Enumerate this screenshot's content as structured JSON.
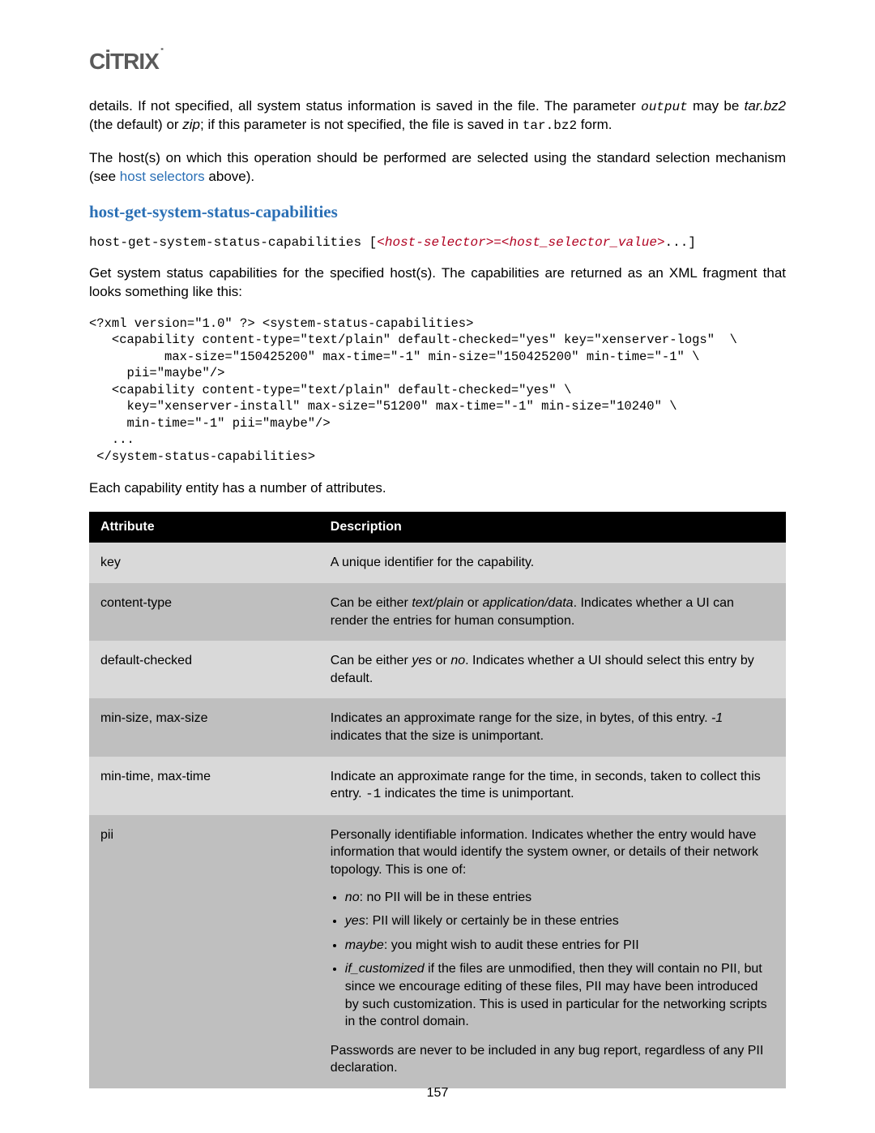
{
  "logo": {
    "text": "CİTRIX",
    "trademark": "˙"
  },
  "intro": {
    "p1_a": "details. If not specified, all system status information is saved in the file. The parameter ",
    "p1_output": "output",
    "p1_b": " may be ",
    "p1_tarbz2": "tar.bz2",
    "p1_c": " (the default) or ",
    "p1_zip": "zip",
    "p1_d": "; if this parameter is not specified, the file is saved in ",
    "p1_tarbz2_mono": "tar.bz2",
    "p1_e": " form.",
    "p2_a": "The host(s) on which this operation should be performed are selected using the standard selection mechanism (see ",
    "p2_link": "host selectors",
    "p2_b": " above)."
  },
  "section_heading": "host-get-system-status-capabilities",
  "cmd": {
    "name": "host-get-system-status-capabilities",
    "open": " [",
    "sel": "<host-selector>",
    "eq": "=",
    "val": "<host_selector_value>",
    "close": "...]"
  },
  "desc_para": "Get system status capabilities for the specified host(s). The capabilities are returned as an XML fragment that looks something like this:",
  "xml_block": "<?xml version=\"1.0\" ?> <system-status-capabilities>\n   <capability content-type=\"text/plain\" default-checked=\"yes\" key=\"xenserver-logs\"  \\\n          max-size=\"150425200\" max-time=\"-1\" min-size=\"150425200\" min-time=\"-1\" \\\n     pii=\"maybe\"/>\n   <capability content-type=\"text/plain\" default-checked=\"yes\" \\\n     key=\"xenserver-install\" max-size=\"51200\" max-time=\"-1\" min-size=\"10240\" \\\n     min-time=\"-1\" pii=\"maybe\"/>\n   ...\n </system-status-capabilities>",
  "attrs_intro": "Each capability entity has a number of attributes.",
  "table": {
    "head_attr": "Attribute",
    "head_desc": "Description",
    "rows": [
      {
        "attr": "key",
        "desc_plain": "A unique identifier for the capability."
      },
      {
        "attr": "content-type",
        "desc_a": "Can be either ",
        "it1": "text/plain",
        "desc_b": " or ",
        "it2": "application/data",
        "desc_c": ". Indicates whether a UI can render the entries for human consumption."
      },
      {
        "attr": "default-checked",
        "desc_a": "Can be either ",
        "it1": "yes",
        "desc_b": " or ",
        "it2": "no",
        "desc_c": ". Indicates whether a UI should select this entry by default."
      },
      {
        "attr": "min-size, max-size",
        "desc_a": "Indicates an approximate range for the size, in bytes, of this entry. ",
        "it1": "-1",
        "desc_c": " indicates that the size is unimportant."
      },
      {
        "attr": "min-time, max-time",
        "desc_a": "Indicate an approximate range for the time, in seconds, taken to collect this entry. ",
        "mono1": "-1",
        "desc_c": " indicates the time is unimportant."
      },
      {
        "attr": "pii",
        "intro": "Personally identifiable information. Indicates whether the entry would have information that would identify the system owner, or details of their network topology. This is one of:",
        "li1_it": "no",
        "li1_rest": ": no PII will be in these entries",
        "li2_it": "yes",
        "li2_rest": ": PII will likely or certainly be in these entries",
        "li3_it": "maybe",
        "li3_rest": ": you might wish to audit these entries for PII",
        "li4_it": "if_customized",
        "li4_rest": " if the files are unmodified, then they will contain no PII, but since we encourage editing of these files, PII may have been introduced by such customization. This is used in particular for the networking scripts in the control domain.",
        "foot": "Passwords are never to be included in any bug report, regardless of any PII declaration."
      }
    ]
  },
  "page_number": "157"
}
